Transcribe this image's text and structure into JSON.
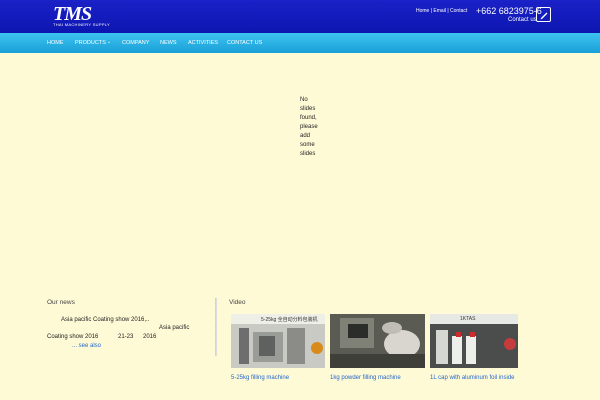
{
  "header": {
    "logo_text": "TMS",
    "logo_subtitle": "THAI MACHINERY SUPPLY",
    "links": [
      "Home",
      "Email",
      "Contact"
    ],
    "link_separator": " | ",
    "phone": "+662 6823975-6",
    "contact_us": "Contact us",
    "colors": {
      "topbar": "#1a22c8",
      "navbar": "#2aaee4"
    }
  },
  "nav": {
    "items": [
      "HOME",
      "PRODUCTS",
      "COMPANY",
      "NEWS",
      "ACTIVITIES",
      "CONTACT US"
    ],
    "caret": "⌄"
  },
  "slider": {
    "message": "No slides found, please add some slides"
  },
  "news": {
    "title": "Our news",
    "item_title": "Asia pacific Coating show 2016,..",
    "item_title2": "Asia pacific",
    "item_line": "Coating show 2016",
    "item_dates": "21-23",
    "item_year": "2016",
    "see_also": "... see also"
  },
  "video": {
    "title": "Video",
    "items": [
      {
        "caption": "5-25kg filling machine",
        "overlay": "5-25kg 全自动分料包装机"
      },
      {
        "caption": "1kg powder filling machine",
        "overlay": ""
      },
      {
        "caption": "1L cap with aluminum foil inside",
        "overlay": "1KTAS"
      }
    ]
  }
}
